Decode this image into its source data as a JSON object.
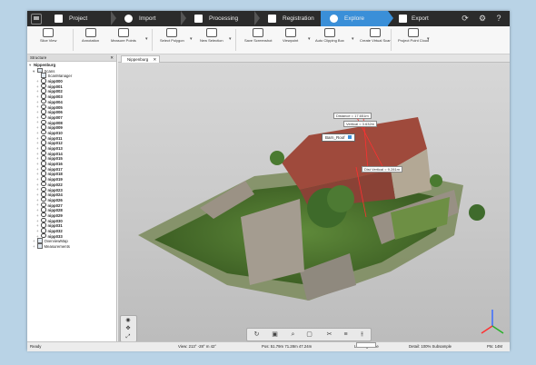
{
  "workflow": {
    "steps": [
      {
        "label": "Project",
        "active": false
      },
      {
        "label": "Import",
        "active": false
      },
      {
        "label": "Processing",
        "active": false
      },
      {
        "label": "Registration",
        "active": false
      },
      {
        "label": "Explore",
        "active": true
      },
      {
        "label": "Export",
        "active": false
      }
    ]
  },
  "ribbon": {
    "tools": [
      {
        "label": "Slice View"
      },
      {
        "label": "Annotation"
      },
      {
        "label": "Measure Points"
      },
      {
        "label": "Select Polygon"
      },
      {
        "label": "New Selection"
      },
      {
        "label": "Save Screenshot"
      },
      {
        "label": "Viewpoint"
      },
      {
        "label": "Auto Clipping Box"
      },
      {
        "label": "Create Virtual Scan"
      },
      {
        "label": "Project Point Cloud"
      }
    ]
  },
  "structure": {
    "title": "Structure",
    "root": "Nippenburg",
    "scans_label": "Scans",
    "scan_manager": "ScanManager",
    "scans": [
      "nipp000",
      "nipp001",
      "nipp002",
      "nipp003",
      "nipp004",
      "nipp005",
      "nipp006",
      "nipp007",
      "nipp008",
      "nipp009",
      "nipp010",
      "nipp011",
      "nipp012",
      "nipp013",
      "nipp014",
      "nipp015",
      "nipp016",
      "nipp017",
      "nipp018",
      "nipp019",
      "nipp022",
      "nipp023",
      "nipp024",
      "nipp026",
      "nipp027",
      "nipp028",
      "nipp029",
      "nipp030",
      "nipp031",
      "nipp032",
      "nipp033"
    ],
    "overview": "OverviewMap",
    "measurements": "Measurements"
  },
  "viewport": {
    "tab": "Nippenburg",
    "annotations": {
      "distance": "Distance = 17.651m",
      "vertical": "Vertical = 3.632m",
      "tag": "Barn_Roof",
      "other": "Dist Vertical = 9.281m"
    }
  },
  "status": {
    "ready": "Ready",
    "view": "View: 213° -28° m 42°",
    "pos": "Pos: 51.79m 71.28m 47.24m",
    "loading": "Loading Done",
    "detail": "Detail: 100% Subsample",
    "pts": "Pts: 14M"
  },
  "colors": {
    "accent": "#3a8fd8",
    "topbar": "#2b2b2b"
  }
}
